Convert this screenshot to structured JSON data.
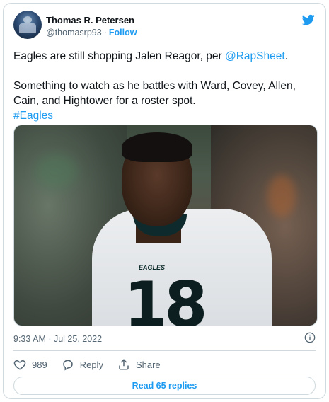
{
  "author": {
    "name": "Thomas R. Petersen",
    "handle": "@thomasrp93",
    "separator": "·",
    "follow_label": "Follow"
  },
  "tweet": {
    "line1_prefix": "Eagles are still shopping Jalen Reagor, per ",
    "mention": "@RapSheet",
    "line1_suffix": ".",
    "line2": "Something to watch as he battles with Ward, Covey, Allen, Cain, and Hightower for a roster spot.",
    "hashtag": "#Eagles"
  },
  "media": {
    "jersey_number": "18",
    "jersey_wordmark": "EAGLES"
  },
  "timestamp": "9:33 AM · Jul 25, 2022",
  "actions": {
    "like_count": "989",
    "reply_label": "Reply",
    "share_label": "Share"
  },
  "read_replies_label": "Read 65 replies",
  "icons": {
    "brand": "twitter-bird-icon",
    "info": "info-icon",
    "like": "heart-icon",
    "reply": "reply-bubble-icon",
    "share": "share-icon"
  },
  "colors": {
    "accent": "#1d9bf0",
    "text": "#0f1419",
    "muted": "#536471",
    "border": "#cfd9de"
  }
}
